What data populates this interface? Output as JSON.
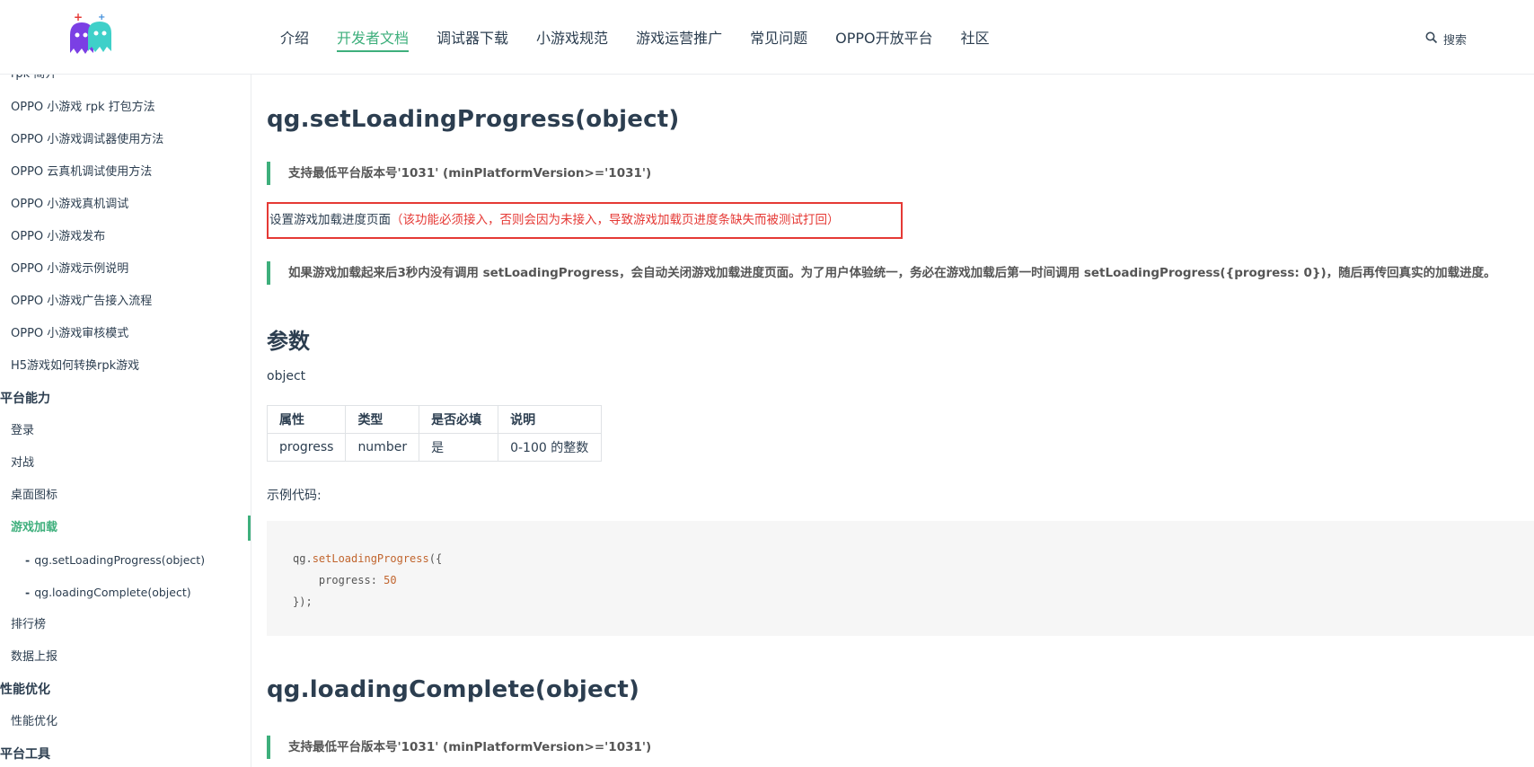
{
  "nav": {
    "items": [
      "介绍",
      "开发者文档",
      "调试器下载",
      "小游戏规范",
      "游戏运营推广",
      "常见问题",
      "OPPO开放平台",
      "社区"
    ],
    "active_index": 1,
    "search_label": "搜索"
  },
  "sidebar": {
    "partial_top": "rpk 简介",
    "items": [
      "OPPO 小游戏 rpk 打包方法",
      "OPPO 小游戏调试器使用方法",
      "OPPO 云真机调试使用方法",
      "OPPO 小游戏真机调试",
      "OPPO 小游戏发布",
      "OPPO 小游戏示例说明",
      "OPPO 小游戏广告接入流程",
      "OPPO 小游戏审核模式",
      "H5游戏如何转换rpk游戏"
    ],
    "group_platform": "平台能力",
    "platform_items": [
      "登录",
      "对战",
      "桌面图标",
      "游戏加载"
    ],
    "sub_items": [
      "qg.setLoadingProgress(object)",
      "qg.loadingComplete(object)"
    ],
    "more_items": [
      "排行榜",
      "数据上报"
    ],
    "group_perf": "性能优化",
    "perf_items": [
      "性能优化"
    ],
    "group_tools": "平台工具"
  },
  "content": {
    "title1": "qg.setLoadingProgress(object)",
    "tip1": "支持最低平台版本号'1031' (minPlatformVersion>='1031')",
    "desc_black": "设置游戏加载进度页面",
    "desc_red": "（该功能必须接入，否则会因为未接入，导致游戏加载页进度条缺失而被测试打回）",
    "tip2": "如果游戏加载起来后3秒内没有调用 setLoadingProgress，会自动关闭游戏加载进度页面。为了用户体验统一，务必在游戏加载后第一时间调用 setLoadingProgress({progress: 0})，随后再传回真实的加载进度。",
    "params_heading": "参数",
    "object_label": "object",
    "table": {
      "headers": [
        "属性",
        "类型",
        "是否必填",
        "说明"
      ],
      "rows": [
        [
          "progress",
          "number",
          "是",
          "0-100 的整数"
        ]
      ]
    },
    "example_label": "示例代码:",
    "code": {
      "l1_obj": "qg.",
      "l1_fn": "setLoadingProgress",
      "l1_end": "({",
      "l2_key": "    progress: ",
      "l2_num": "50",
      "l3": "});"
    },
    "title2": "qg.loadingComplete(object)",
    "tip3": "支持最低平台版本号'1031' (minPlatformVersion>='1031')"
  },
  "colors": {
    "accent": "#3eaf7c",
    "warning": "#e53935",
    "text": "#2c3e50"
  }
}
